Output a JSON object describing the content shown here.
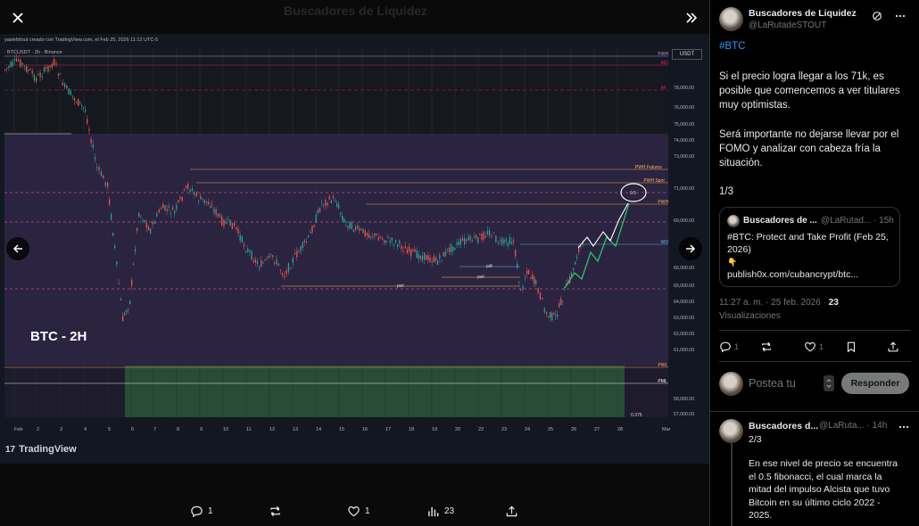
{
  "viewer": {
    "bg_title": "Buscadores de Liquidez",
    "close_icon": "close-icon",
    "collapse_icon": "double-chevron-right-icon",
    "prev_icon": "arrow-left-icon",
    "next_icon": "arrow-right-icon",
    "bg_post_name": "Buscadores de Liqu...",
    "bg_post_name2": "Buscadores de Liquidez"
  },
  "chart": {
    "header": "yasiefstout creado con TradingView.com, el Feb 25, 2026 11:12 UTC-5",
    "symbol": "BTCUSDT · 2h · Binance",
    "currency": "USDT",
    "overlay_label": "BTC - 2H",
    "brand": "TradingView",
    "x_labels": [
      "Feb",
      "2",
      "3",
      "4",
      "5",
      "6",
      "7",
      "8",
      "9",
      "10",
      "11",
      "12",
      "13",
      "14",
      "15",
      "16",
      "17",
      "18",
      "19",
      "20",
      "22",
      "23",
      "24",
      "25",
      "26",
      "27",
      "28",
      "Mar"
    ],
    "y_labels": [
      "78,000.00",
      "76,000.00",
      "75,000.00",
      "74,000.00",
      "73,000.00",
      "71,000.00",
      "69,000.00",
      "66,000.00",
      "65,000.00",
      "64,000.00",
      "63,000.00",
      "62,000.00",
      "61,000.00",
      "58,000.00",
      "57,000.00"
    ],
    "level_tags": [
      {
        "label": "PWH",
        "value": "",
        "color": "#b39ddb"
      },
      {
        "label": "MO",
        "value": "78,741.90",
        "color": "#e91e63"
      },
      {
        "label": "AF",
        "value": "77,249.16",
        "color": "#e91e63"
      },
      {
        "label": "PWH Futuros",
        "value": "72,271.41",
        "color": "#ffb74d"
      },
      {
        "label": "PWH Spot",
        "value": "71,486.08",
        "color": "#ffb74d"
      },
      {
        "label": "PWH",
        "value": "70,126.67",
        "color": "#ffb74d"
      },
      {
        "label": "WO",
        "value": "",
        "color": "#4dd0e1"
      },
      {
        "label": "PWL",
        "value": "60,000.00",
        "color": "#ffb74d"
      },
      {
        "label": "PML",
        "value": "58,946.00",
        "color": "#ffffff"
      }
    ],
    "in_chart_labels": [
      "0.5",
      "pdl",
      "pwl",
      "pwl",
      "0.375"
    ]
  },
  "viewer_actions": {
    "reply_count": "1",
    "repost_count": "",
    "like_count": "1",
    "views_count": "23"
  },
  "post": {
    "author": "Buscadores de Liquidez",
    "handle": "@LaRutadeSTOUT",
    "hashtag": "#BTC",
    "para1": "Si el precio logra llegar a los 71k, es posible que comencemos a ver titulares muy optimistas.",
    "para2": "Será importante no dejarse llevar por el FOMO y analizar con cabeza fría la situación.",
    "para3": "1/3",
    "quote": {
      "author": "Buscadores de ...",
      "handle": "@LaRutad... · 15h",
      "text": "#BTC: Protect and Take Profit (Feb 25, 2026)",
      "emoji": "👇",
      "link": "publish0x.com/cubancrypt/btc..."
    },
    "time": "11:27 a. m. · 25 feb. 2026 · ",
    "views": "23",
    "views_label": "Visualizaciones",
    "reply_count": "1",
    "repost_count": "",
    "like_count": "1"
  },
  "reply": {
    "placeholder": "Postea tu",
    "button": "Responder"
  },
  "post2": {
    "author": "Buscadores d...",
    "handle": "@LaRuta... · 14h",
    "num": "2/3",
    "text": "En ese nivel de precio se encuentra el 0.5 fibonacci, el cual marca la mitad del impulso Alcista que tuvo Bitcoin en su último ciclo 2022 - 2025."
  }
}
